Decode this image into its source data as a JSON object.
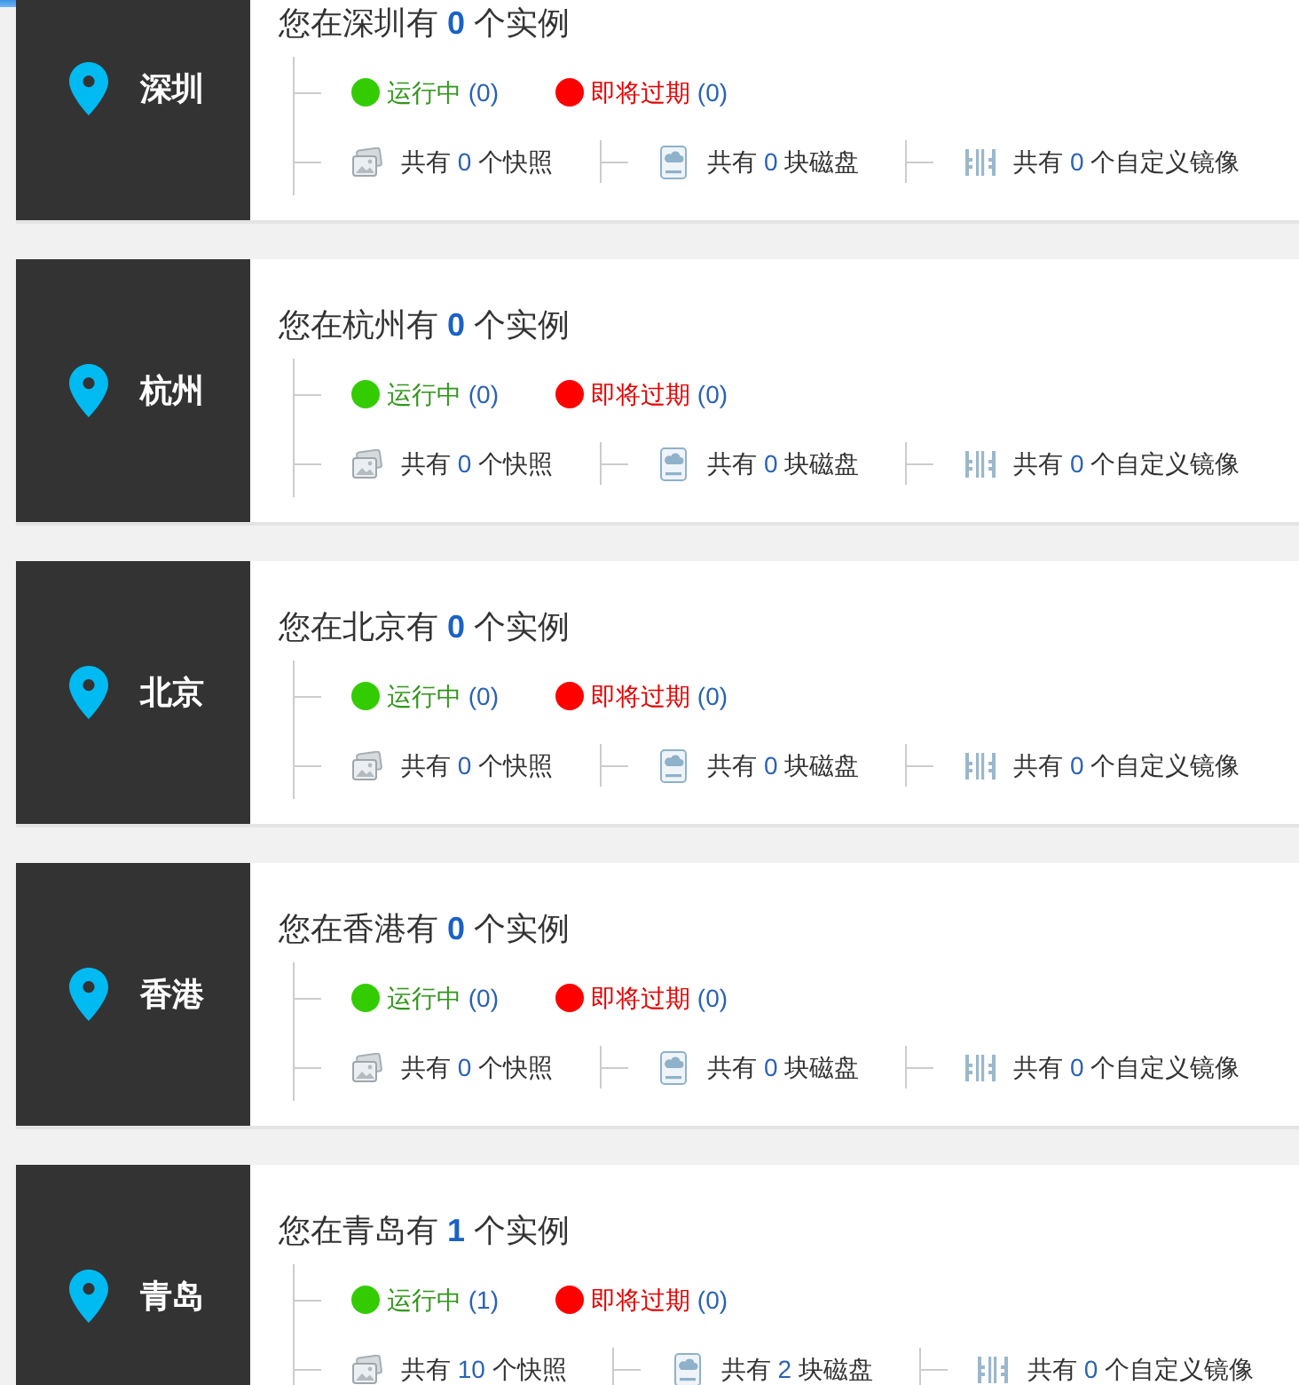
{
  "regions": [
    {
      "city": "深圳",
      "title": {
        "before": "您在深圳有",
        "count": "0",
        "after": "个实例"
      },
      "statuses": [
        {
          "kind": "running",
          "color": "#33cc00",
          "label": "运行中",
          "count": "(0)"
        },
        {
          "kind": "expiring",
          "color": "#ff0000",
          "label": "即将过期",
          "count": "(0)"
        }
      ],
      "resources": [
        {
          "kind": "snapshot",
          "before": "共有",
          "count": "0",
          "after": "个快照"
        },
        {
          "kind": "disk",
          "before": "共有",
          "count": "0",
          "after": "块磁盘"
        },
        {
          "kind": "image",
          "before": "共有",
          "count": "0",
          "after": "个自定义镜像"
        }
      ]
    },
    {
      "city": "杭州",
      "title": {
        "before": "您在杭州有",
        "count": "0",
        "after": "个实例"
      },
      "statuses": [
        {
          "kind": "running",
          "color": "#33cc00",
          "label": "运行中",
          "count": "(0)"
        },
        {
          "kind": "expiring",
          "color": "#ff0000",
          "label": "即将过期",
          "count": "(0)"
        }
      ],
      "resources": [
        {
          "kind": "snapshot",
          "before": "共有",
          "count": "0",
          "after": "个快照"
        },
        {
          "kind": "disk",
          "before": "共有",
          "count": "0",
          "after": "块磁盘"
        },
        {
          "kind": "image",
          "before": "共有",
          "count": "0",
          "after": "个自定义镜像"
        }
      ]
    },
    {
      "city": "北京",
      "title": {
        "before": "您在北京有",
        "count": "0",
        "after": "个实例"
      },
      "statuses": [
        {
          "kind": "running",
          "color": "#33cc00",
          "label": "运行中",
          "count": "(0)"
        },
        {
          "kind": "expiring",
          "color": "#ff0000",
          "label": "即将过期",
          "count": "(0)"
        }
      ],
      "resources": [
        {
          "kind": "snapshot",
          "before": "共有",
          "count": "0",
          "after": "个快照"
        },
        {
          "kind": "disk",
          "before": "共有",
          "count": "0",
          "after": "块磁盘"
        },
        {
          "kind": "image",
          "before": "共有",
          "count": "0",
          "after": "个自定义镜像"
        }
      ]
    },
    {
      "city": "香港",
      "title": {
        "before": "您在香港有",
        "count": "0",
        "after": "个实例"
      },
      "statuses": [
        {
          "kind": "running",
          "color": "#33cc00",
          "label": "运行中",
          "count": "(0)"
        },
        {
          "kind": "expiring",
          "color": "#ff0000",
          "label": "即将过期",
          "count": "(0)"
        }
      ],
      "resources": [
        {
          "kind": "snapshot",
          "before": "共有",
          "count": "0",
          "after": "个快照"
        },
        {
          "kind": "disk",
          "before": "共有",
          "count": "0",
          "after": "块磁盘"
        },
        {
          "kind": "image",
          "before": "共有",
          "count": "0",
          "after": "个自定义镜像"
        }
      ]
    },
    {
      "city": "青岛",
      "title": {
        "before": "您在青岛有",
        "count": "1",
        "after": "个实例"
      },
      "statuses": [
        {
          "kind": "running",
          "color": "#33cc00",
          "label": "运行中",
          "count": "(1)"
        },
        {
          "kind": "expiring",
          "color": "#ff0000",
          "label": "即将过期",
          "count": "(0)"
        }
      ],
      "resources": [
        {
          "kind": "snapshot",
          "before": "共有",
          "count": "10",
          "after": "个快照"
        },
        {
          "kind": "disk",
          "before": "共有",
          "count": "2",
          "after": "块磁盘"
        },
        {
          "kind": "image",
          "before": "共有",
          "count": "0",
          "after": "个自定义镜像"
        }
      ]
    }
  ]
}
